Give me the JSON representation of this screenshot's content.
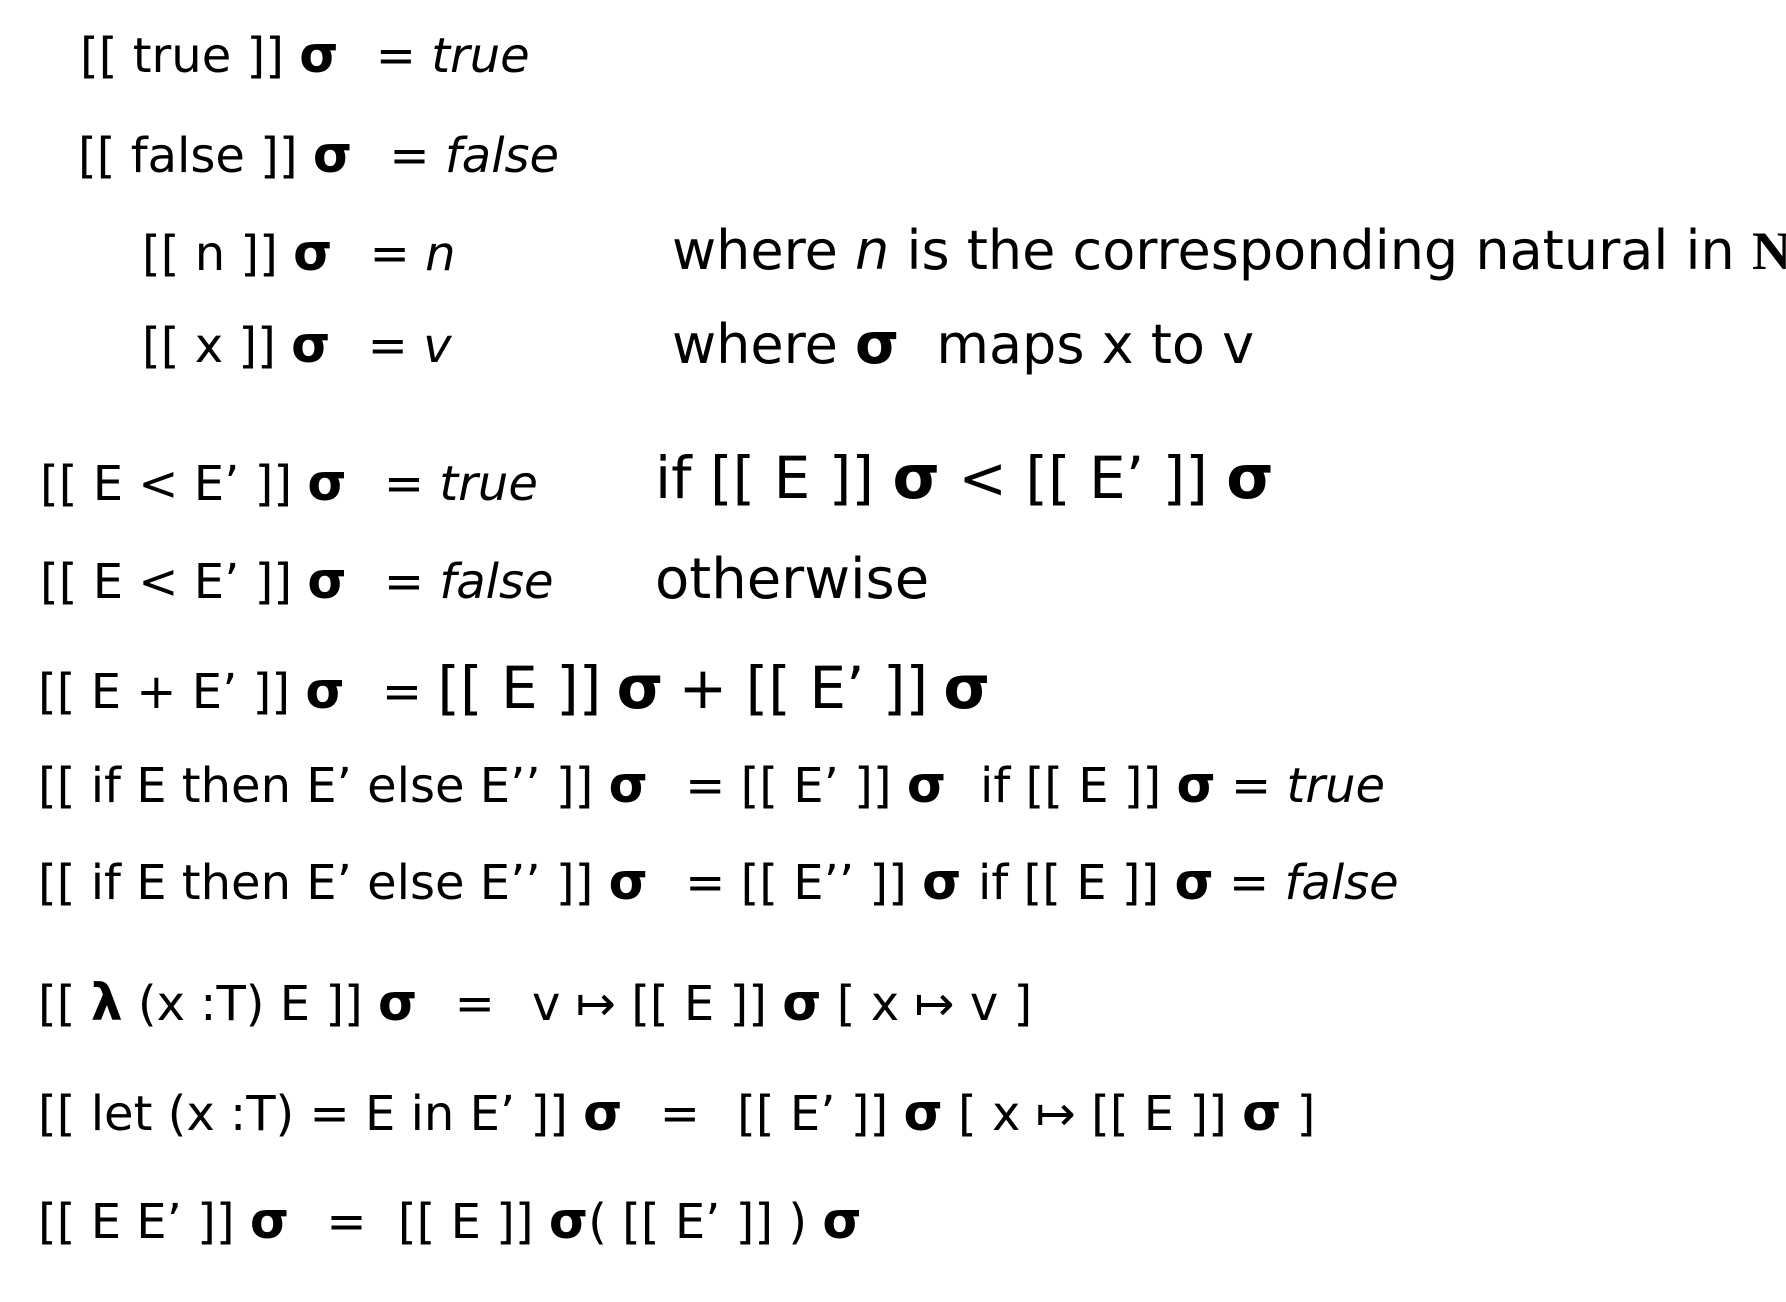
{
  "sigma": "σ",
  "lines": {
    "true_lhs": "[[ true ]]",
    "true_rhs_eq": "=",
    "true_rhs": "true",
    "false_lhs": "[[ false ]]",
    "false_rhs_eq": "=",
    "false_rhs": "false",
    "n_lhs": "[[ n ]]",
    "n_rhs_eq": "=",
    "n_rhs": "n",
    "n_where_prefix": "where",
    "n_where_var": "n",
    "n_where_mid": "is the corresponding natural in",
    "n_where_set": "N",
    "x_lhs": "[[ x ]]",
    "x_rhs_eq": "=",
    "x_rhs": "v",
    "x_where_prefix": "where",
    "x_where_suffix": "maps x to v",
    "lt_true_lhs": "[[ E < E’ ]]",
    "lt_true_eq": "=",
    "lt_true_rhs": "true",
    "lt_true_cond_prefix": "if  [[ E ]]",
    "lt_true_cond_mid": "< [[ E’ ]]",
    "lt_false_lhs": "[[ E < E’ ]]",
    "lt_false_eq": "=",
    "lt_false_rhs": "false",
    "lt_false_cond": "otherwise",
    "plus_lhs": "[[ E + E’ ]]",
    "plus_eq": "=",
    "plus_rhs_a": "[[ E ]]",
    "plus_rhs_b": "+ [[ E’ ]]",
    "if1_lhs": "[[ if E then E’ else E’’ ]]",
    "if1_eq": "=",
    "if1_rhs": "[[ E’ ]]",
    "if1_cond_a": "if [[ E ]]",
    "if1_cond_b": "=",
    "if1_cond_c": "true",
    "if2_lhs": "[[ if E then E’ else E’’ ]]",
    "if2_eq": "=",
    "if2_rhs": "[[ E’’ ]]",
    "if2_cond_a": "if [[ E ]]",
    "if2_cond_b": "=",
    "if2_cond_c": "false",
    "lam_open": "[[",
    "lam_symbol": "λ",
    "lam_body": "(x :T) E ]]",
    "lam_eq": "=",
    "lam_rhs_a": "v ↦  [[ E ]]",
    "lam_rhs_b": "[ x ↦ v ]",
    "let_lhs": "[[ let (x :T) = E in E’ ]]",
    "let_eq": "=",
    "let_rhs_a": "[[ E’ ]]",
    "let_rhs_b": "[ x ↦ [[ E ]]",
    "let_rhs_c": "]",
    "app_lhs": "[[ E  E’ ]]",
    "app_eq": "=",
    "app_rhs_a": "[[ E ]]",
    "app_rhs_b": "( [[ E’ ]] )"
  }
}
